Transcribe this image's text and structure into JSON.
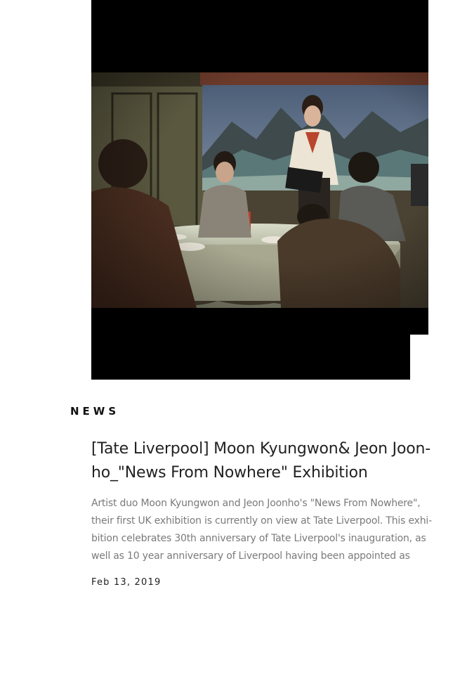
{
  "slider": {
    "image_description_icon": "film-still-image",
    "prev_icon": "chevron-left-icon",
    "next_icon": "chevron-right-icon"
  },
  "section": {
    "label": "NEWS"
  },
  "post": {
    "title": "[Tate Liverpool] Moon Kyungwon& Jeon Joon-ho_\"News From Nowhere\" Exhibition",
    "excerpt": "Artist duo Moon Kyungwon and Jeon Joonho's \"News From Nowhere\", their first UK exhibition is currently on view at Tate Liverpool. This exhi-bition celebrates 30th anniversary of Tate Liverpool's inauguration, as well as 10 year anniversary of Liverpool having been appointed as",
    "date": "Feb 13, 2019"
  },
  "colors": {
    "background": "#ffffff",
    "letterbox": "#000000",
    "title_text": "#222222",
    "excerpt_text": "#7a7a7a"
  }
}
